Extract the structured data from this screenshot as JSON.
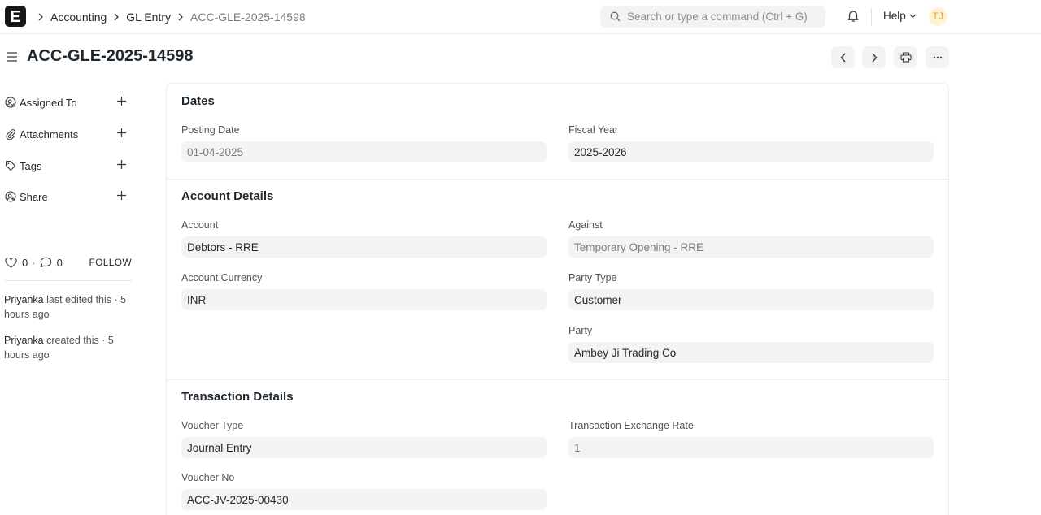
{
  "navbar": {
    "breadcrumbs": [
      "Accounting",
      "GL Entry",
      "ACC-GLE-2025-14598"
    ],
    "search_placeholder": "Search or type a command (Ctrl + G)",
    "help_label": "Help",
    "user_initials": "TJ"
  },
  "page": {
    "title": "ACC-GLE-2025-14598"
  },
  "sidebar": {
    "items": [
      {
        "label": "Assigned To",
        "icon": "assign-icon"
      },
      {
        "label": "Attachments",
        "icon": "paperclip-icon"
      },
      {
        "label": "Tags",
        "icon": "tag-icon"
      },
      {
        "label": "Share",
        "icon": "share-icon"
      }
    ],
    "likes_count": "0",
    "comments_count": "0",
    "follow_label": "FOLLOW",
    "activity": [
      {
        "user": "Priyanka",
        "text": " last edited this · 5 hours ago"
      },
      {
        "user": "Priyanka",
        "text": " created this · 5 hours ago"
      }
    ]
  },
  "form": {
    "sections": {
      "dates": "Dates",
      "account": "Account Details",
      "transaction": "Transaction Details"
    },
    "fields": {
      "posting_date": {
        "label": "Posting Date",
        "value": "01-04-2025"
      },
      "fiscal_year": {
        "label": "Fiscal Year",
        "value": "2025-2026"
      },
      "account": {
        "label": "Account",
        "value": "Debtors - RRE"
      },
      "against": {
        "label": "Against",
        "value": "Temporary Opening - RRE"
      },
      "account_currency": {
        "label": "Account Currency",
        "value": "INR"
      },
      "party_type": {
        "label": "Party Type",
        "value": "Customer"
      },
      "party": {
        "label": "Party",
        "value": "Ambey Ji Trading Co"
      },
      "voucher_type": {
        "label": "Voucher Type",
        "value": "Journal Entry"
      },
      "transaction_exchange_rate": {
        "label": "Transaction Exchange Rate",
        "value": "1"
      },
      "voucher_no": {
        "label": "Voucher No",
        "value": "ACC-JV-2025-00430"
      }
    }
  },
  "colors": {
    "field_bg": "#f3f3f3",
    "border": "#ebeef0",
    "avatar_bg": "#fff3d6",
    "avatar_text": "#e5a21b",
    "text": "#1f272e",
    "muted": "#7c7c7c"
  }
}
